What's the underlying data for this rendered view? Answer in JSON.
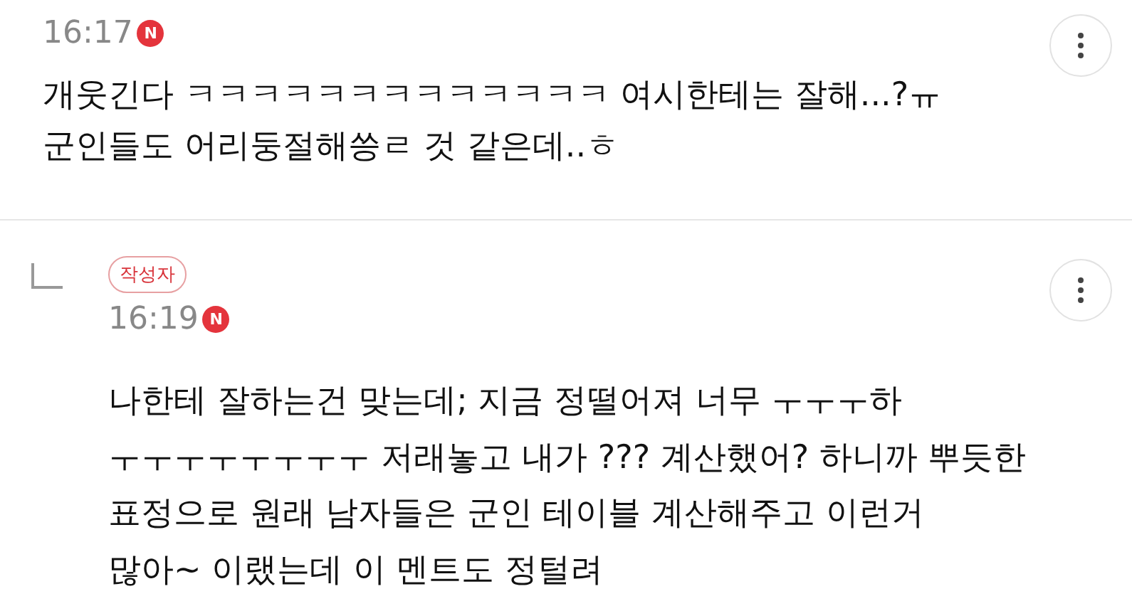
{
  "comments": [
    {
      "kind": "comment",
      "time": "16:17",
      "new_badge": "N",
      "text": "개웃긴다 ㅋㅋㅋㅋㅋㅋㅋㅋㅋㅋㅋㅋㅋ 여시한테는 잘해...?ㅠ\n군인들도 어리둥절해씅ㄹ 것 같은데..ㅎ"
    },
    {
      "kind": "reply",
      "author_tag": "작성자",
      "time": "16:19",
      "new_badge": "N",
      "text": "나한테 잘하는건 맞는데; 지금 정떨어져 너무 ㅜㅜㅜ하\nㅜㅜㅜㅜㅜㅜㅜㅜ 저래놓고 내가 ??? 계산했어? 하니까 뿌듯한\n표정으로 원래 남자들은 군인 테이블 계산해주고 이런거\n많아~ 이랬는데 이 멘트도 정털려"
    }
  ]
}
